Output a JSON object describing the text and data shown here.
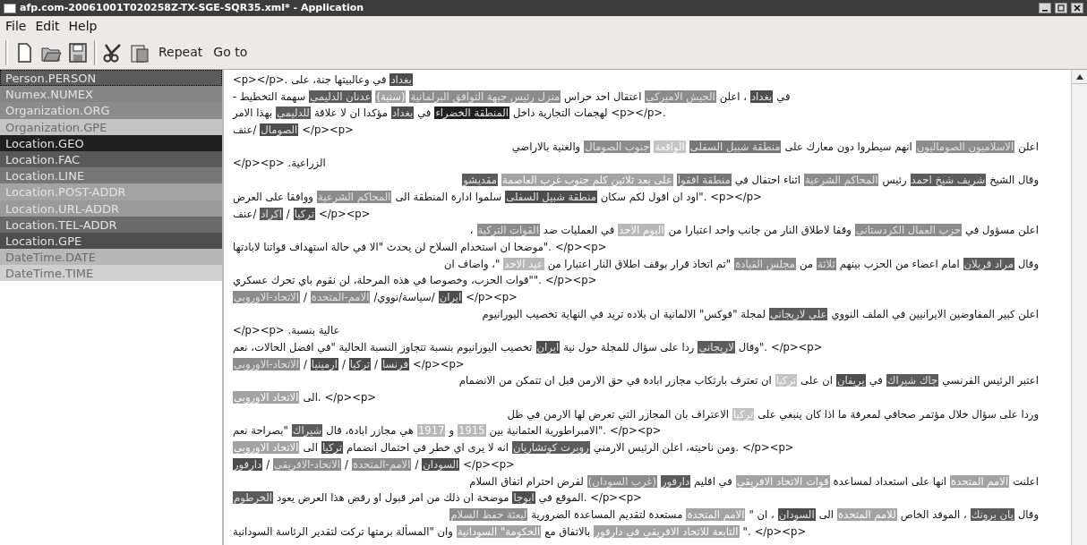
{
  "window": {
    "title": "afp.com-20061001T020258Z-TX-SGE-SQR35.xml* - Application"
  },
  "menu": {
    "file": "File",
    "edit": "Edit",
    "help": "Help"
  },
  "toolbar": {
    "repeat_button": "Repeat",
    "goto_button": "Go to"
  },
  "sidebar": {
    "items": [
      {
        "label": "Person.PERSON",
        "color": "#5c5c5c",
        "selected": true
      },
      {
        "label": "Numex.NUMEX",
        "color": "#858585",
        "selected": false
      },
      {
        "label": "Organization.ORG",
        "color": "#8c8c8c",
        "selected": false
      },
      {
        "label": "Organization.GPE",
        "color": "#c4c4c4",
        "selected": false
      },
      {
        "label": "Location.GEO",
        "color": "#202020",
        "selected": false
      },
      {
        "label": "Location.FAC",
        "color": "#595959",
        "selected": false
      },
      {
        "label": "Location.LINE",
        "color": "#767676",
        "selected": false
      },
      {
        "label": "Location.POST-ADDR",
        "color": "#a3a3a3",
        "selected": false
      },
      {
        "label": "Location.URL-ADDR",
        "color": "#9a9a9a",
        "selected": false
      },
      {
        "label": "Location.TEL-ADDR",
        "color": "#6a6a6a",
        "selected": false
      },
      {
        "label": "Location.GPE",
        "color": "#4d4d4d",
        "selected": false
      },
      {
        "label": "DateTime.DATE",
        "color": "#b8b8b8",
        "selected": false
      },
      {
        "label": "DateTime.TIME",
        "color": "#cfcfcf",
        "selected": false
      }
    ]
  },
  "document": {
    "lines": [
      {
        "kind": "end",
        "segments": [
          {
            "kind": "entity",
            "text": "بغداد",
            "color": "#4d4d4d"
          },
          {
            "kind": "text",
            "text": "في وعالبيتها جنة، على"
          },
          {
            "kind": "markup",
            "text": "<p></p>."
          }
        ]
      },
      {
        "kind": "full",
        "segments": [
          {
            "kind": "text",
            "text": "في"
          },
          {
            "kind": "entity",
            "text": "بغداد",
            "color": "#4d4d4d"
          },
          {
            "kind": "text",
            "text": "، اعلن"
          },
          {
            "kind": "entity",
            "text": "الجيش الاميركي",
            "color": "#8c8c8c"
          },
          {
            "kind": "text",
            "text": "اعتقال احد حراس"
          },
          {
            "kind": "entity",
            "text": "منزل رئيس جبهة التوافق البرلمانية",
            "color": "#8c8c8c"
          },
          {
            "kind": "entity",
            "text": "(سنية)",
            "color": "#a3a3a3"
          },
          {
            "kind": "entity",
            "text": "عدنان الدليمي",
            "color": "#5c5c5c"
          },
          {
            "kind": "text",
            "text": "سهمة التخطيط -"
          }
        ]
      },
      {
        "kind": "end",
        "segments": [
          {
            "kind": "markup",
            "text": "<p></p>."
          },
          {
            "kind": "text",
            "text": "لهجمات التجارية داخل"
          },
          {
            "kind": "entity",
            "text": "المنطقة الخضراء",
            "color": "#202020"
          },
          {
            "kind": "text",
            "text": "في"
          },
          {
            "kind": "entity",
            "text": "بغداد",
            "color": "#4d4d4d"
          },
          {
            "kind": "text",
            "text": "مؤكدا ان لا علاقة"
          },
          {
            "kind": "entity",
            "text": "للدليمي",
            "color": "#5c5c5c"
          },
          {
            "kind": "text",
            "text": "بهذا الامر"
          }
        ]
      },
      {
        "kind": "end",
        "segments": [
          {
            "kind": "markup",
            "text": "</p><p>"
          },
          {
            "kind": "entity",
            "text": "الصومال",
            "color": "#4d4d4d"
          },
          {
            "kind": "text",
            "text": "/عنف"
          }
        ]
      },
      {
        "kind": "start",
        "segments": [
          {
            "kind": "text",
            "text": "اعلن"
          },
          {
            "kind": "entity",
            "text": "الاسلاميون الصوماليون",
            "color": "#8c8c8c"
          },
          {
            "kind": "text",
            "text": "انهم سيطروا دون معارك على"
          },
          {
            "kind": "entity",
            "text": "منطقة شبيل السفلى",
            "color": "#767676"
          },
          {
            "kind": "entity",
            "text": "الواقعة",
            "color": "#c4c4c4"
          },
          {
            "kind": "entity",
            "text": "جنوب الصومال",
            "color": "#8c8c8c"
          },
          {
            "kind": "text",
            "text": "والغنية بالاراضي"
          }
        ]
      },
      {
        "kind": "end",
        "segments": [
          {
            "kind": "text",
            "text": "الزراعية."
          },
          {
            "kind": "markup",
            "text": "</p><p>"
          }
        ]
      },
      {
        "kind": "start",
        "segments": [
          {
            "kind": "text",
            "text": "وقال الشيخ"
          },
          {
            "kind": "entity",
            "text": "شريف شيخ احمد",
            "color": "#5c5c5c"
          },
          {
            "kind": "text",
            "text": "رئيس"
          },
          {
            "kind": "entity",
            "text": "المحاكم الشرعية",
            "color": "#8c8c8c"
          },
          {
            "kind": "text",
            "text": "اثناء احتفال في"
          },
          {
            "kind": "entity",
            "text": "منطقة افقوا",
            "color": "#767676"
          },
          {
            "kind": "entity",
            "text": "على بعد ثلاثين كلم جنوب غرب العاصمة",
            "color": "#a3a3a3"
          },
          {
            "kind": "entity",
            "text": "مقديشو",
            "color": "#5c5c5c"
          }
        ]
      },
      {
        "kind": "full",
        "segments": [
          {
            "kind": "markup",
            "text": "<p></p>"
          },
          {
            "kind": "text",
            "text": ".\"اود ان اقول لكم سكان"
          },
          {
            "kind": "entity",
            "text": "منطقة شبيل السفلى",
            "color": "#4d4d4d"
          },
          {
            "kind": "text",
            "text": "سلموا ادارة المنطقة الى"
          },
          {
            "kind": "entity",
            "text": "المحاكم الشرعية",
            "color": "#8c8c8c"
          },
          {
            "kind": "text",
            "text": "ووافقا على العرض"
          }
        ]
      },
      {
        "kind": "end",
        "segments": [
          {
            "kind": "markup",
            "text": "</p><p>"
          },
          {
            "kind": "entity",
            "text": "تركيا",
            "color": "#4d4d4d"
          },
          {
            "kind": "text",
            "text": "/"
          },
          {
            "kind": "entity",
            "text": "اكراد",
            "color": "#5c5c5c"
          },
          {
            "kind": "text",
            "text": "/عنف"
          }
        ]
      },
      {
        "kind": "start",
        "segments": [
          {
            "kind": "text",
            "text": "اعلن مسؤول في"
          },
          {
            "kind": "entity",
            "text": "حزب العمال الكردستاني",
            "color": "#8c8c8c"
          },
          {
            "kind": "text",
            "text": "وقفا لاطلاق النار من جانب واحد اعتبارا من"
          },
          {
            "kind": "entity",
            "text": "اليوم الاحد",
            "color": "#b8b8b8"
          },
          {
            "kind": "text",
            "text": "في العمليات ضد"
          },
          {
            "kind": "entity",
            "text": "القوات التركية",
            "color": "#8c8c8c"
          },
          {
            "kind": "text",
            "text": "،"
          }
        ]
      },
      {
        "kind": "full",
        "segments": [
          {
            "kind": "markup",
            "text": "</p><p>"
          },
          {
            "kind": "text",
            "text": ".\"موضحا ان استخدام السلاح لن يحدث \"الا في حالة استهداف قواتنا لابادتها"
          }
        ]
      },
      {
        "kind": "start",
        "segments": [
          {
            "kind": "text",
            "text": "وقال"
          },
          {
            "kind": "entity",
            "text": "مراد قريلان",
            "color": "#5c5c5c"
          },
          {
            "kind": "text",
            "text": "امام اعضاء من الحزب بينهم"
          },
          {
            "kind": "entity",
            "text": "ثلاثة",
            "color": "#858585"
          },
          {
            "kind": "text",
            "text": "من"
          },
          {
            "kind": "entity",
            "text": "مجلس القيادة",
            "color": "#8c8c8c"
          },
          {
            "kind": "text",
            "text": "\"تم اتخاذ قرار بوقف اطلاق النار اعتبارا من"
          },
          {
            "kind": "entity",
            "text": "عيد الاحد",
            "color": "#b8b8b8"
          },
          {
            "kind": "text",
            "text": "\"، واضاف ان"
          }
        ]
      },
      {
        "kind": "full",
        "segments": [
          {
            "kind": "markup",
            "text": "</p><p>"
          },
          {
            "kind": "text",
            "text": ".\"\"قوات الحزب، وخصوصا في هذه المرحلة، لن نقوم باي تحرك عسكري"
          }
        ]
      },
      {
        "kind": "end",
        "segments": [
          {
            "kind": "markup",
            "text": "</p><p>"
          },
          {
            "kind": "entity",
            "text": "ايران",
            "color": "#4d4d4d"
          },
          {
            "kind": "text",
            "text": "/سياسة/نووي/"
          },
          {
            "kind": "entity",
            "text": "الامم-المتحدة",
            "color": "#8c8c8c"
          },
          {
            "kind": "text",
            "text": "/"
          },
          {
            "kind": "entity",
            "text": "الاتحاد-الاوروبي",
            "color": "#8c8c8c"
          }
        ]
      },
      {
        "kind": "start",
        "segments": [
          {
            "kind": "text",
            "text": "اعلن كبير المفاوضين الايرانيين في الملف النووي"
          },
          {
            "kind": "entity",
            "text": "علي لاريجاني",
            "color": "#5c5c5c"
          },
          {
            "kind": "text",
            "text": "لمجلة \"فوكس\" الالمانية ان بلاده تريد في النهاية تخصيب اليورانيوم"
          }
        ]
      },
      {
        "kind": "end",
        "segments": [
          {
            "kind": "text",
            "text": "عالية بنسبة."
          },
          {
            "kind": "markup",
            "text": "</p><p>"
          }
        ]
      },
      {
        "kind": "full",
        "segments": [
          {
            "kind": "markup",
            "text": "</p><p>"
          },
          {
            "kind": "text",
            "text": ".\"وقال"
          },
          {
            "kind": "entity",
            "text": "لاريجاني",
            "color": "#5c5c5c"
          },
          {
            "kind": "text",
            "text": "ردا على سؤال للمجلة حول نية"
          },
          {
            "kind": "entity",
            "text": "ايران",
            "color": "#4d4d4d"
          },
          {
            "kind": "text",
            "text": "تخصيب اليورانيوم بنسبة تتجاوز النسبة الحالية \"في افضل الحالات، نعم"
          }
        ]
      },
      {
        "kind": "end",
        "segments": [
          {
            "kind": "markup",
            "text": "</p><p>"
          },
          {
            "kind": "entity",
            "text": "فرنسا",
            "color": "#4d4d4d"
          },
          {
            "kind": "text",
            "text": "/"
          },
          {
            "kind": "entity",
            "text": "تركيا",
            "color": "#4d4d4d"
          },
          {
            "kind": "text",
            "text": "/"
          },
          {
            "kind": "entity",
            "text": "ارمينيا",
            "color": "#4d4d4d"
          },
          {
            "kind": "text",
            "text": "/"
          },
          {
            "kind": "entity",
            "text": "الاتحاد-الاوروبي",
            "color": "#8c8c8c"
          }
        ]
      },
      {
        "kind": "start",
        "segments": [
          {
            "kind": "text",
            "text": "اعتبر الرئيس الفرنسي"
          },
          {
            "kind": "entity",
            "text": "جاك شيراك",
            "color": "#5c5c5c"
          },
          {
            "kind": "text",
            "text": "في"
          },
          {
            "kind": "entity",
            "text": "يريفان",
            "color": "#4d4d4d"
          },
          {
            "kind": "text",
            "text": "ان على"
          },
          {
            "kind": "entity",
            "text": "تركيا",
            "color": "#c4c4c4"
          },
          {
            "kind": "text",
            "text": "ان تعترف بارتكاب مجازر ابادة في حق الارمن قبل ان تتمكن من الانضمام"
          }
        ]
      },
      {
        "kind": "end",
        "segments": [
          {
            "kind": "markup",
            "text": "</p><p>"
          },
          {
            "kind": "text",
            "text": ".الى"
          },
          {
            "kind": "entity",
            "text": "الاتحاد الاوروبي",
            "color": "#a3a3a3"
          }
        ]
      },
      {
        "kind": "start",
        "segments": [
          {
            "kind": "text",
            "text": "وردا على سؤال خلال مؤتمر صحافي لمعرفة ما اذا كان ينبغي على"
          },
          {
            "kind": "entity",
            "text": "تركيا",
            "color": "#c4c4c4"
          },
          {
            "kind": "text",
            "text": "الاعتراف بان المجازر التي تعرض لها الارمن في ظل"
          }
        ]
      },
      {
        "kind": "full",
        "segments": [
          {
            "kind": "markup",
            "text": "</p><p>"
          },
          {
            "kind": "text",
            "text": ".\"الامبراطورية العثمانية بين"
          },
          {
            "kind": "entity",
            "text": "1915",
            "color": "#b8b8b8"
          },
          {
            "kind": "text",
            "text": "و"
          },
          {
            "kind": "entity",
            "text": "1917",
            "color": "#b8b8b8"
          },
          {
            "kind": "text",
            "text": "هي مجازر ابادة، قال"
          },
          {
            "kind": "entity",
            "text": "شيراك",
            "color": "#5c5c5c"
          },
          {
            "kind": "text",
            "text": "\"بصراحة نعم"
          }
        ]
      },
      {
        "kind": "full",
        "segments": [
          {
            "kind": "markup",
            "text": "</p><p>"
          },
          {
            "kind": "text",
            "text": ".ومن ناحيته، اعلن الرئيس الارمني"
          },
          {
            "kind": "entity",
            "text": "روبرت كوتشاريان",
            "color": "#5c5c5c"
          },
          {
            "kind": "text",
            "text": "انه لا يرى اي خطر في احتمال انضمام"
          },
          {
            "kind": "entity",
            "text": "تركيا",
            "color": "#4d4d4d"
          },
          {
            "kind": "text",
            "text": "الى"
          },
          {
            "kind": "entity",
            "text": "الاتحاد الاوروبي",
            "color": "#a3a3a3"
          }
        ]
      },
      {
        "kind": "end",
        "segments": [
          {
            "kind": "markup",
            "text": "</p><p>"
          },
          {
            "kind": "entity",
            "text": "السودان",
            "color": "#4d4d4d"
          },
          {
            "kind": "text",
            "text": "/"
          },
          {
            "kind": "entity",
            "text": "الامم-المتحدة",
            "color": "#8c8c8c"
          },
          {
            "kind": "text",
            "text": "/"
          },
          {
            "kind": "entity",
            "text": "الاتحاد-الافريقي",
            "color": "#8c8c8c"
          },
          {
            "kind": "text",
            "text": "/"
          },
          {
            "kind": "entity",
            "text": "دارفور",
            "color": "#4d4d4d"
          }
        ]
      },
      {
        "kind": "start",
        "segments": [
          {
            "kind": "text",
            "text": "اعلنت"
          },
          {
            "kind": "entity",
            "text": "الامم المتحدة",
            "color": "#a3a3a3"
          },
          {
            "kind": "text",
            "text": "انها على استعداد لمساعدة"
          },
          {
            "kind": "entity",
            "text": "قوات الاتحاد الافريقي",
            "color": "#a3a3a3"
          },
          {
            "kind": "text",
            "text": "في اقليم"
          },
          {
            "kind": "entity",
            "text": "دارفور",
            "color": "#5c5c5c"
          },
          {
            "kind": "entity",
            "text": "(غرب السودان)",
            "color": "#8c8c8c"
          },
          {
            "kind": "text",
            "text": "لفرض احترام اتفاق السلام"
          }
        ]
      },
      {
        "kind": "full",
        "segments": [
          {
            "kind": "markup",
            "text": "</p><p>"
          },
          {
            "kind": "text",
            "text": ".الموقع في"
          },
          {
            "kind": "entity",
            "text": "ابوجا",
            "color": "#4d4d4d"
          },
          {
            "kind": "text",
            "text": "موضحة ان ذلك من امر قبول او رفض هذا العرض يعود"
          },
          {
            "kind": "entity",
            "text": "الخرطوم",
            "color": "#5c5c5c"
          }
        ]
      },
      {
        "kind": "start",
        "segments": [
          {
            "kind": "text",
            "text": "وقال"
          },
          {
            "kind": "entity",
            "text": "يان برونك",
            "color": "#5c5c5c"
          },
          {
            "kind": "text",
            "text": "، الموفد الخاص"
          },
          {
            "kind": "entity",
            "text": "للامم المتحدة",
            "color": "#a3a3a3"
          },
          {
            "kind": "text",
            "text": "الى"
          },
          {
            "kind": "entity",
            "text": "السودان",
            "color": "#4d4d4d"
          },
          {
            "kind": "text",
            "text": "، ان \""
          },
          {
            "kind": "entity",
            "text": "الامم المتحدة",
            "color": "#a3a3a3"
          },
          {
            "kind": "text",
            "text": "مستعدة لتقديم المساعدة الضرورية"
          },
          {
            "kind": "entity",
            "text": "لبعثة حفظ السلام",
            "color": "#8c8c8c"
          }
        ]
      },
      {
        "kind": "full",
        "segments": [
          {
            "kind": "markup",
            "text": "</p><p>"
          },
          {
            "kind": "text",
            "text": ".\""
          },
          {
            "kind": "entity",
            "text": "التابعة للاتحاد الافريقي في دارفور",
            "color": "#a3a3a3"
          },
          {
            "kind": "text",
            "text": "بالاتفاق مع"
          },
          {
            "kind": "entity",
            "text": "الحكومة\" السودانية",
            "color": "#a3a3a3"
          },
          {
            "kind": "text",
            "text": "وان \"المسألة برمتها تركت لتقدير"
          },
          {
            "kind": "text",
            "text": "الرئاسة السودانية"
          }
        ]
      }
    ]
  }
}
